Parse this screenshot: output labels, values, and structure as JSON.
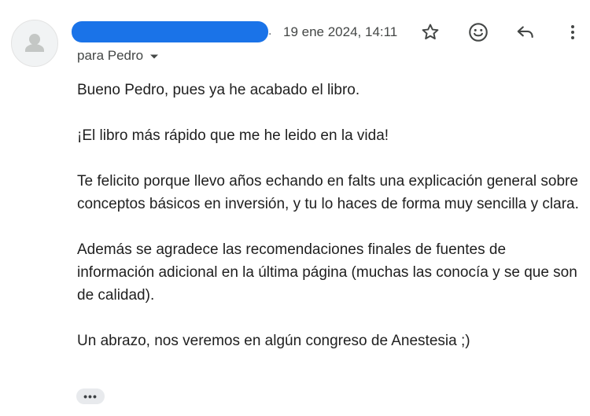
{
  "header": {
    "sender_separator": ".",
    "date": "19 ene 2024, 14:11",
    "recipient_label": "para Pedro"
  },
  "actions": {
    "star_icon": "star-outline-icon",
    "emoji_icon": "emoji-smile-icon",
    "reply_icon": "reply-icon",
    "more_icon": "more-vert-icon"
  },
  "message": {
    "paragraphs": [
      "Bueno Pedro, pues ya he acabado el libro.",
      "¡El libro más rápido que me he leido en la vida!",
      "Te felicito porque llevo años echando en falts una explicación general sobre conceptos básicos en inversión, y tu lo haces de forma muy sencilla y clara.",
      "Además se agradece las recomendaciones finales de fuentes de información adicional en la última página (muchas las conocía y se que son de calidad).",
      "Un abrazo, nos veremos en algún congreso de Anestesia ;)"
    ],
    "show_trimmed_label": "•••"
  },
  "colors": {
    "redaction": "#1a73e8",
    "icon": "#444746",
    "text": "#1f1f1f"
  }
}
